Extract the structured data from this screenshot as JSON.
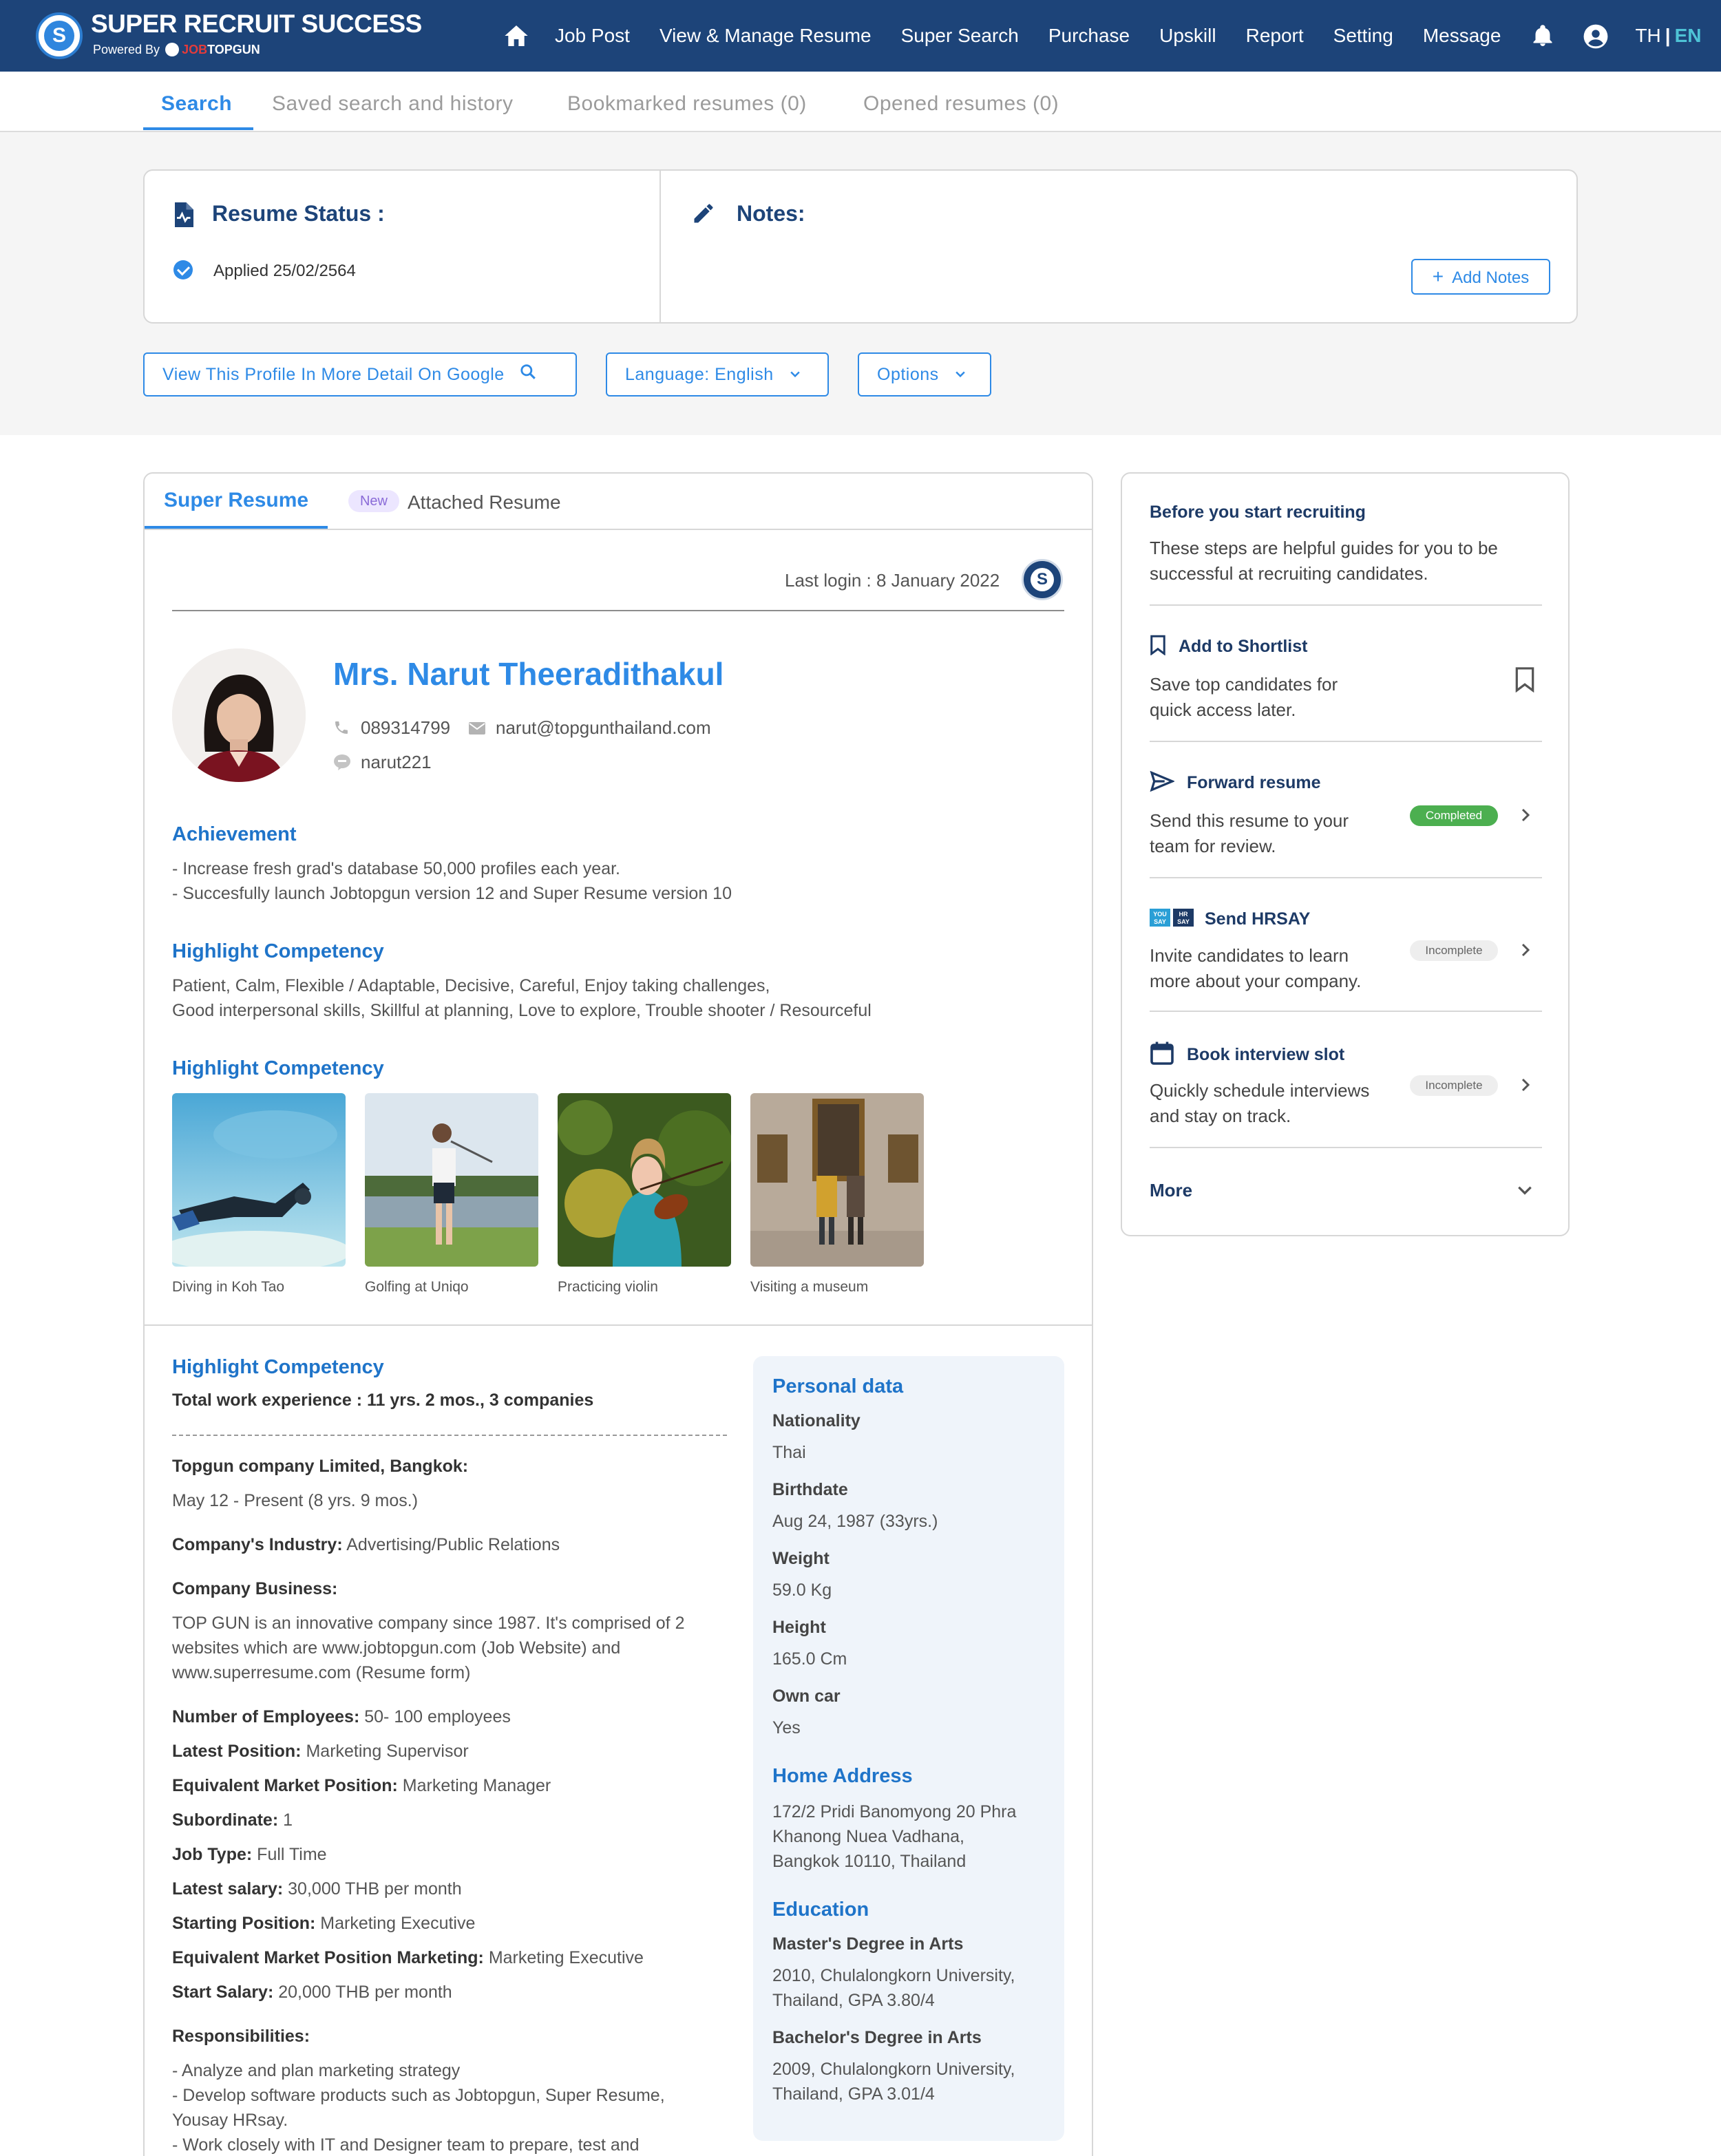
{
  "header": {
    "brand_title": "SUPER RECRUIT SUCCESS",
    "brand_powered": "Powered By",
    "brand_job": "JOB",
    "brand_topgun": "TOPGUN",
    "nav": [
      "Job Post",
      "View & Manage Resume",
      "Super Search",
      "Purchase",
      "Upskill",
      "Report",
      "Setting",
      "Message"
    ],
    "lang_th": "TH",
    "lang_sep": "|",
    "lang_en": "EN"
  },
  "tabs": {
    "search": "Search",
    "saved": "Saved search and history",
    "bookmarked": "Bookmarked resumes (0)",
    "opened": "Opened resumes (0)"
  },
  "status_card": {
    "status_title": "Resume Status :",
    "applied": "Applied 25/02/2564",
    "notes_title": "Notes:",
    "add_notes": "Add Notes"
  },
  "actions": {
    "google": "View This Profile In More Detail On Google",
    "language": "Language: English",
    "options": "Options"
  },
  "resume": {
    "tab_super": "Super Resume",
    "new_badge": "New",
    "tab_attached": "Attached Resume",
    "last_login": "Last login : 8 January 2022",
    "name": "Mrs. Narut Theeradithakul",
    "phone": "089314799",
    "email": "narut@topgunthailand.com",
    "line_id": "narut221",
    "achievement_title": "Achievement",
    "achievements": [
      "- Increase fresh grad's database 50,000 profiles each year.",
      "- Succesfully launch Jobtopgun version 12 and Super Resume version 10"
    ],
    "competency_title": "Highlight Competency",
    "competency_lines": [
      "Patient, Calm, Flexible / Adaptable, Decisive, Careful, Enjoy taking challenges,",
      "Good interpersonal skills, Skillful at planning, Love to explore, Trouble shooter / Resourceful"
    ],
    "photos_title": "Highlight Competency",
    "photo_captions": [
      "Diving in Koh Tao",
      "Golfing at Uniqo",
      "Practicing violin",
      "Visiting a museum"
    ],
    "work_title": "Highlight Competency",
    "total_exp_label": "Total work experience : 11 yrs. 2 mos., 3 companies",
    "company_name": "Topgun company Limited, Bangkok:",
    "company_period": "May 12 - Present (8 yrs. 9 mos.)",
    "industry_label": "Company's Industry:",
    "industry_value": "Advertising/Public Relations",
    "business_label": "Company Business:",
    "business_lines": [
      "TOP GUN is an innovative company since 1987. It's comprised of 2",
      "websites which are www.jobtopgun.com (Job Website) and",
      "www.superresume.com (Resume form)"
    ],
    "employees_label": "Number of Employees:",
    "employees_value": "50- 100 employees",
    "latest_pos_label": "Latest Position:",
    "latest_pos_value": "Marketing Supervisor",
    "equiv_label": "Equivalent Market Position:",
    "equiv_value": "Marketing Manager",
    "subordinate_label": "Subordinate:",
    "subordinate_value": "1",
    "jobtype_label": "Job Type:",
    "jobtype_value": "Full Time",
    "salary_label": "Latest salary:",
    "salary_value": "30,000 THB per month",
    "start_pos_label": "Starting Position:",
    "start_pos_value": "Marketing Executive",
    "equiv_mkt_label": "Equivalent Market Position Marketing:",
    "equiv_mkt_value": "Marketing Executive",
    "start_salary_label": "Start Salary:",
    "start_salary_value": "20,000 THB per month",
    "resp_label": "Responsibilities:",
    "resp_lines": [
      "- Analyze and plan marketing strategy",
      "- Develop software products such as Jobtopgun, Super Resume,",
      "Yousay HRsay.",
      "- Work closely with IT and Designer team to prepare, test and"
    ]
  },
  "personal": {
    "title": "Personal data",
    "nationality_label": "Nationality",
    "nationality": "Thai",
    "birth_label": "Birthdate",
    "birth": "Aug 24, 1987 (33yrs.)",
    "weight_label": "Weight",
    "weight": "59.0 Kg",
    "height_label": "Height",
    "height": "165.0 Cm",
    "car_label": "Own car",
    "car": "Yes",
    "address_title": "Home Address",
    "address_lines": [
      "172/2 Pridi Banomyong 20 Phra",
      "Khanong Nuea Vadhana,",
      "Bangkok 10110, Thailand"
    ],
    "education_title": "Education",
    "master_label": "Master's Degree in Arts",
    "master_lines": [
      "2010, Chulalongkorn University,",
      "Thailand, GPA 3.80/4"
    ],
    "bachelor_label": "Bachelor's Degree in Arts",
    "bachelor_lines": [
      "2009, Chulalongkorn University,",
      "Thailand, GPA 3.01/4"
    ]
  },
  "guide": {
    "title": "Before you start recruiting",
    "intro": [
      "These steps are helpful guides for you to be",
      "successful at recruiting candidates."
    ],
    "shortlist_title": "Add to Shortlist",
    "shortlist_text": [
      "Save top candidates for",
      "quick access later."
    ],
    "forward_title": "Forward resume",
    "forward_text": [
      "Send this resume to your",
      "team for review."
    ],
    "forward_status": "Completed",
    "hrsay_icon_a1": "YOU",
    "hrsay_icon_a2": "SAY",
    "hrsay_icon_b1": "HR",
    "hrsay_icon_b2": "SAY",
    "hrsay_title": "Send HRSAY",
    "hrsay_text": [
      "Invite candidates to learn",
      "more about your company."
    ],
    "hrsay_status": "Incomplete",
    "interview_title": "Book interview slot",
    "interview_text": [
      "Quickly schedule interviews",
      "and stay on track."
    ],
    "interview_status": "Incomplete",
    "more": "More"
  },
  "colors": {
    "header_bg": "#1d4479",
    "accent": "#2e8ae6",
    "heading_blue": "#1f74c9",
    "completed_green": "#4caf50"
  },
  "icons": [
    "home-icon",
    "bell-icon",
    "account-circle-icon",
    "resume-status-icon",
    "pencil-icon",
    "check-circle-icon",
    "search-icon",
    "chevron-down-icon",
    "phone-icon",
    "mail-icon",
    "chat-icon",
    "bookmark-icon",
    "send-icon",
    "calendar-icon",
    "chevron-right-icon"
  ]
}
